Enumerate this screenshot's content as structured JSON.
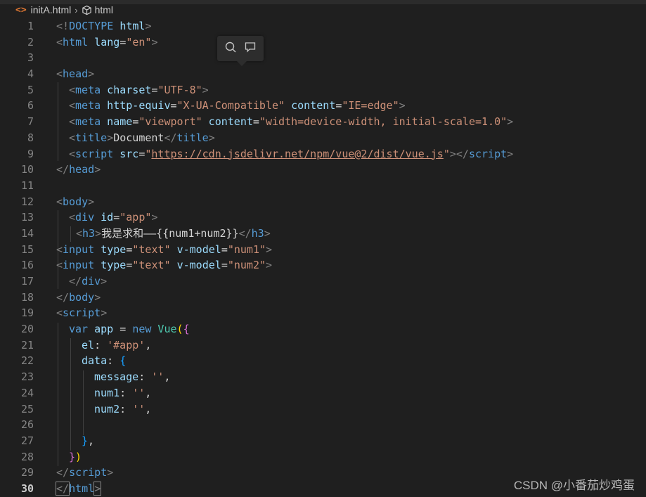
{
  "breadcrumb": {
    "file_icon": "<>",
    "file": "initA.html",
    "separator": "›",
    "symbol": "html"
  },
  "editor": {
    "line_numbers": [
      "1",
      "2",
      "3",
      "4",
      "5",
      "6",
      "7",
      "8",
      "9",
      "10",
      "11",
      "12",
      "13",
      "14",
      "15",
      "16",
      "17",
      "18",
      "19",
      "20",
      "21",
      "22",
      "23",
      "24",
      "25",
      "26",
      "27",
      "28",
      "29",
      "30"
    ],
    "active_line": "30",
    "code": {
      "l1": {
        "open": "<!",
        "doctype": "DOCTYPE",
        "sp": " ",
        "html": "html",
        "close": ">"
      },
      "l2": {
        "open": "<",
        "tag": "html",
        "attr": " lang",
        "eq": "=",
        "val": "\"en\"",
        "close": ">"
      },
      "l4": {
        "open": "<",
        "tag": "head",
        "close": ">"
      },
      "l5": {
        "open": "<",
        "tag": "meta",
        "attr": " charset",
        "eq": "=",
        "val": "\"UTF-8\"",
        "close": ">"
      },
      "l6": {
        "open": "<",
        "tag": "meta",
        "attr1": " http-equiv",
        "eq": "=",
        "val1": "\"X-UA-Compatible\"",
        "attr2": " content",
        "val2": "\"IE=edge\"",
        "close": ">"
      },
      "l7": {
        "open": "<",
        "tag": "meta",
        "attr1": " name",
        "eq": "=",
        "val1": "\"viewport\"",
        "attr2": " content",
        "val2": "\"width=device-width, initial-scale=1.0\"",
        "close": ">"
      },
      "l8": {
        "open": "<",
        "tag": "title",
        "close": ">",
        "text": "Document",
        "open2": "</",
        "close2": ">"
      },
      "l9": {
        "open": "<",
        "tag": "script",
        "attr": " src",
        "eq": "=",
        "q": "\"",
        "url": "https://cdn.jsdelivr.net/npm/vue@2/dist/vue.js",
        "close": ">",
        "open2": "</",
        "close2": ">"
      },
      "l10": {
        "open": "</",
        "tag": "head",
        "close": ">"
      },
      "l12": {
        "open": "<",
        "tag": "body",
        "close": ">"
      },
      "l13": {
        "open": "<",
        "tag": "div",
        "attr": " id",
        "eq": "=",
        "val": "\"app\"",
        "close": ">"
      },
      "l14": {
        "open": "<",
        "tag": "h3",
        "close": ">",
        "text": "我是求和——{{num1+num2}}",
        "open2": "</",
        "close2": ">"
      },
      "l15": {
        "open": "<",
        "tag": "input",
        "attr1": " type",
        "eq": "=",
        "val1": "\"text\"",
        "attr2": " v-model",
        "val2": "\"num1\"",
        "close": ">"
      },
      "l16": {
        "open": "<",
        "tag": "input",
        "attr1": " type",
        "eq": "=",
        "val1": "\"text\"",
        "attr2": " v-model",
        "val2": "\"num2\"",
        "close": ">"
      },
      "l17": {
        "open": "</",
        "tag": "div",
        "close": ">"
      },
      "l18": {
        "open": "</",
        "tag": "body",
        "close": ">"
      },
      "l19": {
        "open": "<",
        "tag": "script",
        "close": ">"
      },
      "l20": {
        "kw": "var",
        "name": " app",
        "op": " = ",
        "new": "new",
        "cls": " Vue",
        "paren": "(",
        "brace": "{"
      },
      "l21": {
        "key": "el",
        "colon": ": ",
        "val": "'#app'",
        "comma": ","
      },
      "l22": {
        "key": "data",
        "colon": ": ",
        "brace": "{"
      },
      "l23": {
        "key": "message",
        "colon": ": ",
        "val": "''",
        "comma": ","
      },
      "l24": {
        "key": "num1",
        "colon": ": ",
        "val": "''",
        "comma": ","
      },
      "l25": {
        "key": "num2",
        "colon": ": ",
        "val": "''",
        "comma": ","
      },
      "l27": {
        "brace": "}",
        "comma": ","
      },
      "l28": {
        "brace": "}",
        "paren": ")"
      },
      "l29": {
        "open": "</",
        "tag": "script",
        "close": ">"
      },
      "l30": {
        "open": "</",
        "tag": "html",
        "close": ">"
      }
    }
  },
  "hover_widget": {
    "icons": [
      "search-icon",
      "comment-icon"
    ]
  },
  "watermark": "CSDN @小番茄炒鸡蛋",
  "colors": {
    "background": "#1f1f1f",
    "tag": "#569cd6",
    "attribute": "#9cdcfe",
    "string": "#ce9178",
    "bracket": "#808080"
  }
}
